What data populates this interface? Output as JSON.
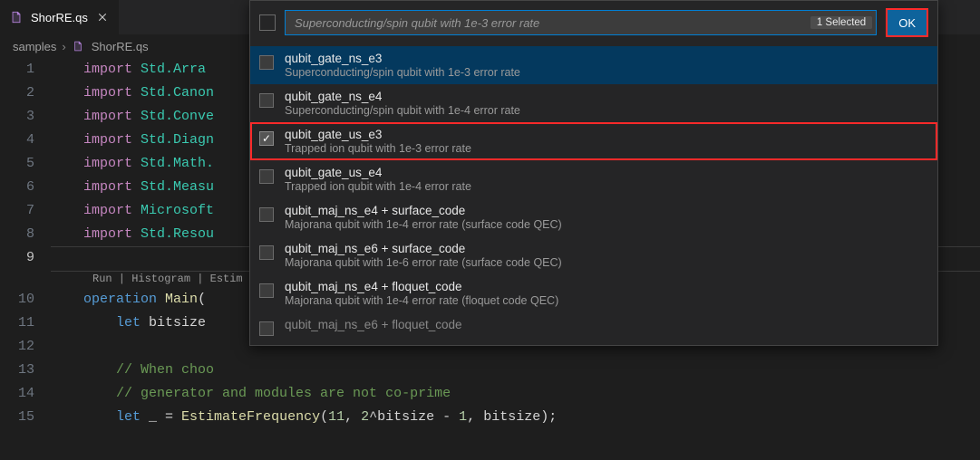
{
  "tab": {
    "filename": "ShorRE.qs"
  },
  "breadcrumb": {
    "folder": "samples",
    "file": "ShorRE.qs"
  },
  "editor": {
    "line_numbers": [
      "1",
      "2",
      "3",
      "4",
      "5",
      "6",
      "7",
      "8",
      "9",
      "10",
      "11",
      "12",
      "13",
      "14",
      "15"
    ],
    "active_line_index": 8,
    "codelens": "Run | Histogram | Estim",
    "code": {
      "import_kw": "import",
      "ns_prefix": "Std.",
      "ns": [
        "Arra",
        "Canon",
        "Conve",
        "Diagn",
        "Math.",
        "Measu",
        "Resou"
      ],
      "ms_prefix": "Microsoft",
      "op_kw": "operation",
      "main_name": "Main",
      "let_kw": "let",
      "bitsize_var": "bitsize",
      "comment1": "// When choo",
      "comment2": "// generator and modules are not co-prime",
      "let_under": "_",
      "eq": " = ",
      "fn_name": "EstimateFrequency",
      "args_open": "(",
      "arg1": "11",
      "comma1": ", ",
      "arg2a": "2",
      "pow": "^",
      "arg2b": "bitsize",
      "minus": " - ",
      "arg2c": "1",
      "comma2": ", ",
      "arg3": "bitsize",
      "args_close": ")",
      "semi": ";"
    }
  },
  "quickpick": {
    "placeholder": "Superconducting/spin qubit with 1e-3 error rate",
    "badge": "1 Selected",
    "ok": "OK",
    "items": [
      {
        "label": "qubit_gate_ns_e3",
        "desc": "Superconducting/spin qubit with 1e-3 error rate",
        "checked": false,
        "focused": true
      },
      {
        "label": "qubit_gate_ns_e4",
        "desc": "Superconducting/spin qubit with 1e-4 error rate",
        "checked": false
      },
      {
        "label": "qubit_gate_us_e3",
        "desc": "Trapped ion qubit with 1e-3 error rate",
        "checked": true,
        "highlight": true
      },
      {
        "label": "qubit_gate_us_e4",
        "desc": "Trapped ion qubit with 1e-4 error rate",
        "checked": false
      },
      {
        "label": "qubit_maj_ns_e4 + surface_code",
        "desc": "Majorana qubit with 1e-4 error rate (surface code QEC)",
        "checked": false
      },
      {
        "label": "qubit_maj_ns_e6 + surface_code",
        "desc": "Majorana qubit with 1e-6 error rate (surface code QEC)",
        "checked": false
      },
      {
        "label": "qubit_maj_ns_e4 + floquet_code",
        "desc": "Majorana qubit with 1e-4 error rate (floquet code QEC)",
        "checked": false
      },
      {
        "label": "qubit_maj_ns_e6 + floquet_code",
        "desc": "",
        "checked": false,
        "cut": true
      }
    ]
  }
}
